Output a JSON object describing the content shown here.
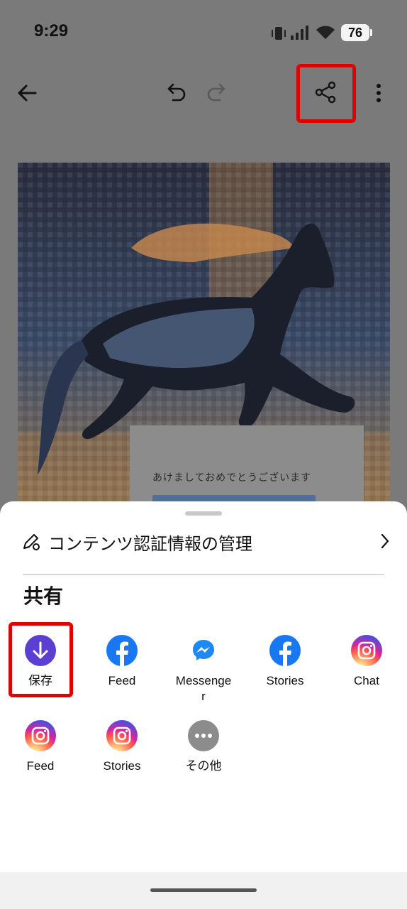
{
  "status_bar": {
    "time": "9:29",
    "battery": "76"
  },
  "toolbar": {
    "back": "back-arrow",
    "undo": "undo",
    "redo": "redo",
    "share": "share",
    "more": "more-vertical"
  },
  "canvas": {
    "greeting": "あけましておめでとうございます"
  },
  "sheet": {
    "content_credentials_label": "コンテンツ認証情報の管理",
    "section_title": "共有",
    "share_targets": [
      {
        "label": "保存",
        "icon": "download-icon"
      },
      {
        "label": "Feed",
        "icon": "facebook-icon"
      },
      {
        "label": "Messenger",
        "icon": "messenger-icon"
      },
      {
        "label": "Stories",
        "icon": "facebook-icon"
      },
      {
        "label": "Chat",
        "icon": "instagram-icon"
      },
      {
        "label": "Feed",
        "icon": "instagram-icon"
      },
      {
        "label": "Stories",
        "icon": "instagram-icon"
      },
      {
        "label": "その他",
        "icon": "more-horizontal-icon"
      }
    ]
  },
  "colors": {
    "highlight": "#e00000",
    "save": "#5b3fd1",
    "facebook": "#1877f2",
    "overlay": "#7a7a7a"
  }
}
